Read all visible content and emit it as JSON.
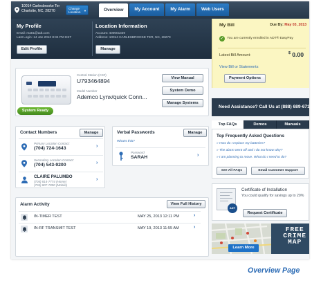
{
  "location": {
    "address_line1": "10014 Carlesbrooke Ter",
    "address_line2": "Charlotte, NC, 28270",
    "change_label_line1": "Change",
    "change_label_line2": "Location"
  },
  "nav_tabs": [
    {
      "label": "Overview",
      "active": true
    },
    {
      "label": "My Account",
      "active": false
    },
    {
      "label": "My Alarm",
      "active": false
    },
    {
      "label": "Web Users",
      "active": false
    }
  ],
  "profile": {
    "title": "My Profile",
    "email_line": "Email: matt1@adt.com",
    "last_login_line": "Last Login: 14 Jan 2013 8:34 PM EST",
    "edit_label": "Edit Profile"
  },
  "location_info": {
    "title": "Location Information",
    "account_line": "Account: 400001339",
    "address_line": "Address: 10014 CARLESBROOKE TER, NC, 28270",
    "manage_label": "Manage"
  },
  "bill": {
    "title": "My Bill",
    "due_prefix": "Due By:",
    "due_date": "May 03, 2013",
    "enrolled_text": "You are currently enrolled in ADT® EasyPay",
    "latest_label": "Latest Bill Amount:",
    "currency": "$",
    "amount": "0.00",
    "view_link": "View Bill or Statements",
    "payment_options": "Payment Options"
  },
  "device": {
    "status": "System Ready",
    "cs_label": "Central Station (CS#)",
    "cs_value": "U793464894",
    "model_label": "Model Number",
    "model_value": "Ademco Lynx/quick Conn...",
    "buttons": [
      "View Manual",
      "System Demo",
      "Manage Systems"
    ]
  },
  "contacts": {
    "title": "Contact Numbers",
    "manage_label": "Manage",
    "rows": [
      {
        "label": "Primary Location Contact:",
        "value": "(704) 724-1643",
        "icon": "map-pin-icon"
      },
      {
        "label": "Secondary Location Contact:",
        "value": "(704) 543-9200",
        "icon": "map-pin-icon"
      },
      {
        "label": "",
        "value": "CLAIRE PALUMBO",
        "sub1": "(704) 814-7774 (Home)",
        "sub2": "(704) 807-7890 (Mobile)",
        "icon": "person-icon"
      }
    ]
  },
  "passwords": {
    "title": "Verbal Passwords",
    "manage_label": "Manage",
    "whats_this": "What's this?",
    "pw_label": "Password",
    "pw_value": "SARAH"
  },
  "alarm": {
    "title": "Alarm Activity",
    "view_history": "View Full History",
    "rows": [
      {
        "event": "IN-TIMER TEST",
        "date": "MAY 25, 2013",
        "time": "12:11 PM"
      },
      {
        "event": "IN-RF TRANSMIT TEST",
        "date": "MAY 19, 2013",
        "time": "11:55 AM"
      }
    ]
  },
  "assist": {
    "text": "Need Assistance? Call Us at (888) 689-6715."
  },
  "faq": {
    "tabs": [
      "Top FAQs",
      "Demos",
      "Manuals"
    ],
    "heading": "Top Frequently Asked Questions",
    "questions": [
      "How do I replace my batteries?",
      "The alarm went off and I do not know why?",
      "I am planning to move. What do I need to do?"
    ],
    "see_all": "See All FAQs",
    "email_support": "Email Customer Support"
  },
  "cert": {
    "title": "Certificate of Installation",
    "subtitle": "You could qualify for savings up to 20%",
    "seal": "ADT",
    "button": "Request Certificate"
  },
  "crime_map": {
    "line1": "FREE",
    "line2": "CRIME",
    "line3": "MAP",
    "learn_more": "Learn More"
  },
  "caption": "Overview Page",
  "colors": {
    "nav_dark": "#26384a",
    "accent_blue": "#1b5d9e",
    "bill_bg": "#fbf6c2",
    "ready_green": "#43891d"
  }
}
